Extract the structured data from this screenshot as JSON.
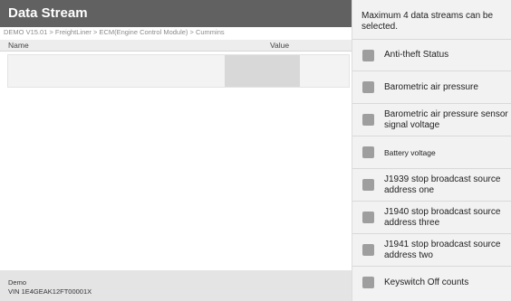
{
  "header": {
    "title": "Data Stream",
    "breadcrumb": "DEMO V15.01 > FreightLiner > ECM(Engine Control Module) > Cummins"
  },
  "table": {
    "columns": {
      "name": "Name",
      "value": "Value"
    }
  },
  "footer": {
    "line1": "Demo",
    "line2": "VIN 1E4GEAK12FT00001X"
  },
  "selector": {
    "hint": "Maximum 4 data streams can be selected.",
    "items": [
      {
        "label": "Anti-theft Status",
        "checked": false
      },
      {
        "label": "Barometric air pressure",
        "checked": false
      },
      {
        "label": "Barometric air pressure sensor signal voltage",
        "checked": false
      },
      {
        "label": "Battery voltage",
        "checked": false
      },
      {
        "label": "J1939 stop broadcast source address one",
        "checked": false
      },
      {
        "label": "J1940 stop broadcast source address three",
        "checked": false
      },
      {
        "label": "J1941 stop broadcast source address two",
        "checked": false
      },
      {
        "label": "Keyswitch Off counts",
        "checked": false
      }
    ]
  }
}
